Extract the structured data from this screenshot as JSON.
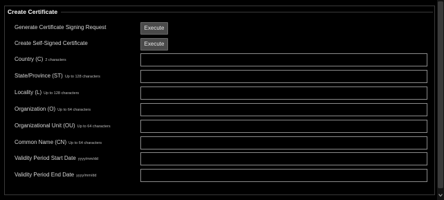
{
  "section": {
    "title": "Create Certificate"
  },
  "actions": [
    {
      "name": "generate-csr",
      "label": "Generate Certificate Signing Request",
      "button": "Execute"
    },
    {
      "name": "create-self-signed",
      "label": "Create Self-Signed Certificate",
      "button": "Execute"
    }
  ],
  "fields": [
    {
      "name": "country",
      "label": "Country (C)",
      "hint": "2 characters",
      "value": ""
    },
    {
      "name": "state-province",
      "label": "State/Province (ST)",
      "hint": "Up to 128 characters",
      "value": ""
    },
    {
      "name": "locality",
      "label": "Locality (L)",
      "hint": "Up to 128 characters",
      "value": ""
    },
    {
      "name": "organization",
      "label": "Organization (O)",
      "hint": "Up to 64 characters",
      "value": ""
    },
    {
      "name": "organizational-unit",
      "label": "Organizational Unit (OU)",
      "hint": "Up to 64 characters",
      "value": ""
    },
    {
      "name": "common-name",
      "label": "Common Name (CN)",
      "hint": "Up to 64 characters",
      "value": ""
    },
    {
      "name": "validity-start",
      "label": "Validity Period Start Date",
      "hint": "yyyy/mm/dd",
      "value": ""
    },
    {
      "name": "validity-end",
      "label": "Validity Period End Date",
      "hint": "yyyy/mm/dd",
      "value": ""
    }
  ],
  "icons": {
    "scroll_down": "chevron-down-icon"
  },
  "colors": {
    "background": "#000000",
    "button": "#4a4a4a",
    "field_border": "#8c8c8c"
  }
}
